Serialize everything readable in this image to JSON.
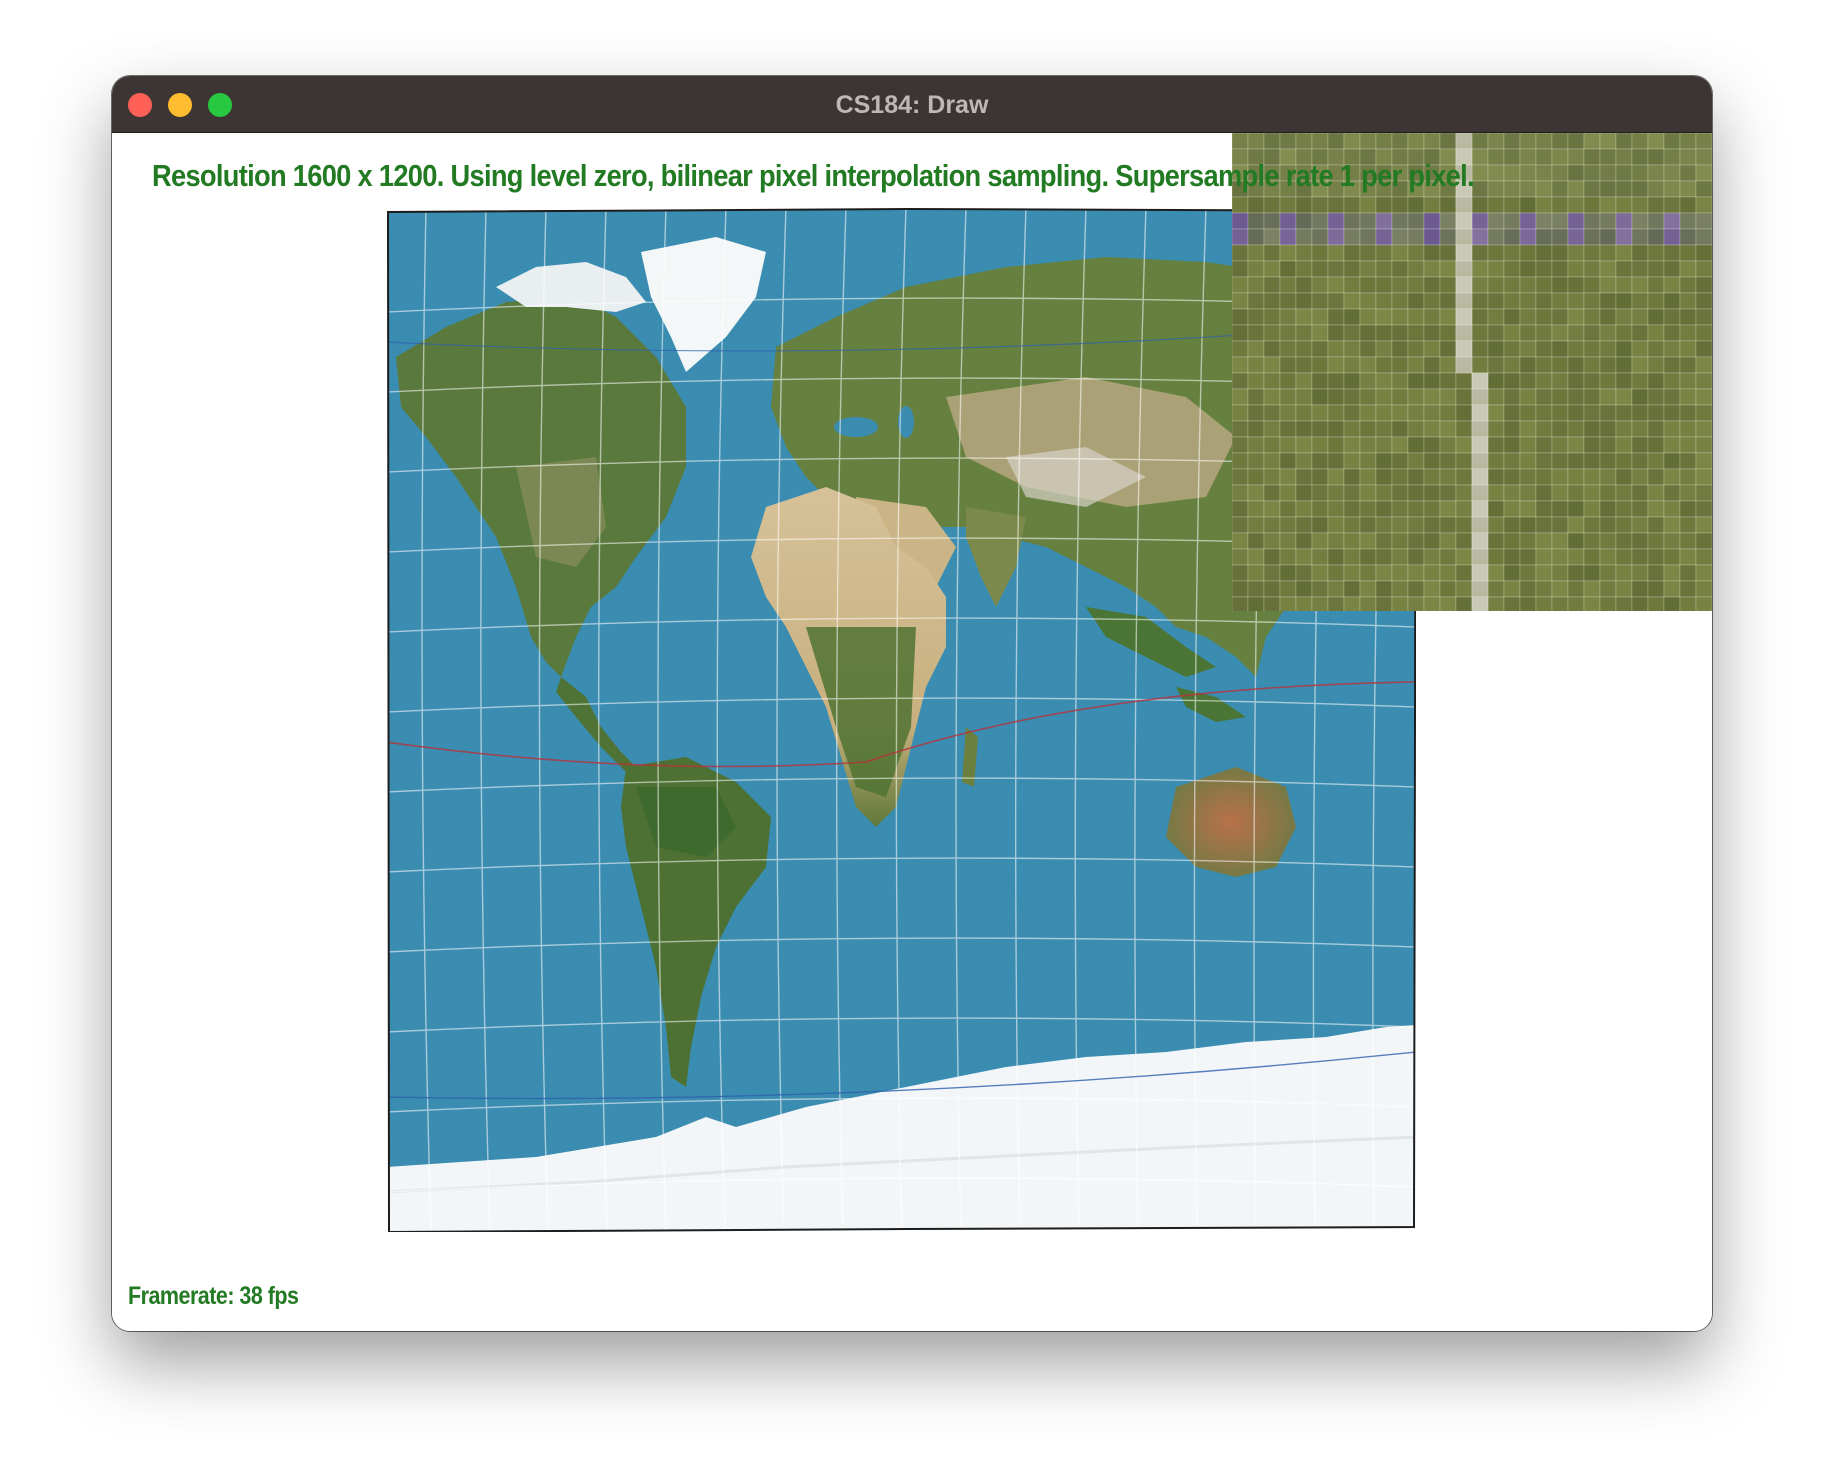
{
  "window": {
    "title": "CS184: Draw",
    "controls": [
      "close",
      "minimize",
      "zoom"
    ]
  },
  "overlay": {
    "status_line": "Resolution 1600 x 1200. Using level zero, bilinear pixel interpolation sampling. Supersample rate 1 per pixel.",
    "framerate": "Framerate: 38 fps"
  },
  "canvas": {
    "content": "world-map-texture",
    "zoom_inset": "magnified-pixel-grid"
  },
  "colors": {
    "text_green": "#227a22",
    "ocean": "#3a8cb1",
    "titlebar": "#3d3533"
  }
}
